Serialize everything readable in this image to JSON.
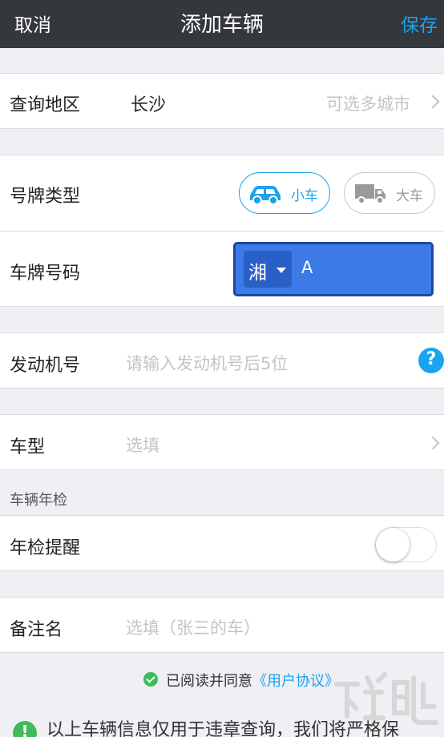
{
  "navbar": {
    "cancel": "取消",
    "title": "添加车辆",
    "save": "保存"
  },
  "region": {
    "label": "查询地区",
    "value": "长沙",
    "hint": "可选多城市"
  },
  "plate_type": {
    "label": "号牌类型",
    "options": [
      "小车",
      "大车"
    ],
    "selected": "小车"
  },
  "plate_number": {
    "label": "车牌号码",
    "prefix": "湘",
    "value": "A"
  },
  "engine": {
    "label": "发动机号",
    "placeholder": "请输入发动机号后5位"
  },
  "model": {
    "label": "车型",
    "placeholder": "选填"
  },
  "inspection": {
    "section": "车辆年检",
    "label": "年检提醒",
    "enabled": false
  },
  "remark": {
    "label": "备注名",
    "placeholder": "选填（张三的车）"
  },
  "agreement": {
    "prefix": "已阅读并同意",
    "link": "《用户协议》"
  },
  "notice": {
    "text": "以上车辆信息仅用于违章查询，我们将严格保"
  },
  "colors": {
    "accent": "#1aa3f0",
    "navbar": "#34373b",
    "plate": "#3c7ae8",
    "success": "#3ebc5b"
  },
  "icons": [
    "chevron-right-icon",
    "car-icon",
    "truck-icon",
    "dropdown-caret-icon",
    "help-icon",
    "check-icon",
    "info-icon"
  ]
}
